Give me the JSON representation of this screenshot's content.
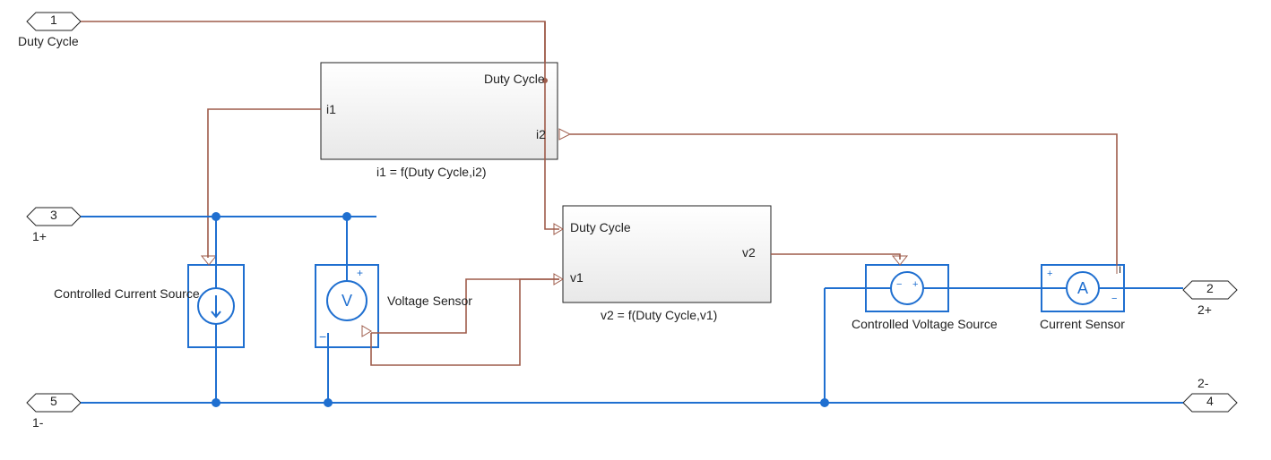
{
  "ports": {
    "p1": {
      "num": "1",
      "label": "Duty Cycle"
    },
    "p3": {
      "num": "3",
      "label": "1+"
    },
    "p5": {
      "num": "5",
      "label": "1-"
    },
    "p2": {
      "num": "2",
      "label": "2+"
    },
    "p4": {
      "num": "4",
      "label": "2-"
    }
  },
  "blocks": {
    "fn1": {
      "ports": {
        "in_top": "Duty Cycle",
        "in_left": "i1",
        "out": "i2"
      },
      "caption": "i1 = f(Duty Cycle,i2)"
    },
    "fn2": {
      "ports": {
        "in_top": "Duty Cycle",
        "in_bot": "v1",
        "out": "v2"
      },
      "caption": "v2 = f(Duty Cycle,v1)"
    },
    "ccs": {
      "label": "Controlled Current Source"
    },
    "vs": {
      "label": "Voltage Sensor"
    },
    "cvs": {
      "label": "Controlled Voltage Source"
    },
    "cs": {
      "label": "Current Sensor"
    }
  },
  "glyphs": {
    "V": "V",
    "A": "A",
    "plus": "+",
    "minus": "−"
  },
  "colors": {
    "signal": "#9e5b4a",
    "power": "#1f6fd0",
    "block": "#bbbbbb",
    "fillTop": "#ffffff",
    "fillBot": "#e6e6e6"
  }
}
